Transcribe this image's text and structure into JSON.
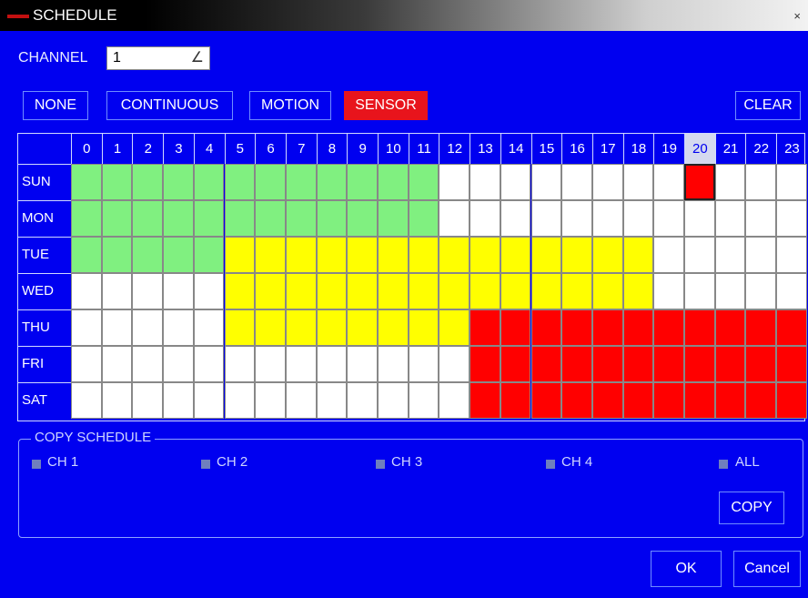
{
  "window": {
    "title": "SCHEDULE",
    "close_glyph": "×"
  },
  "channel": {
    "label": "CHANNEL",
    "value": "1",
    "dropdown_glyph": "∠"
  },
  "modes": {
    "none": "NONE",
    "continuous": "CONTINUOUS",
    "motion": "MOTION",
    "sensor": "SENSOR",
    "clear": "CLEAR"
  },
  "grid": {
    "hours": [
      "0",
      "1",
      "2",
      "3",
      "4",
      "5",
      "6",
      "7",
      "8",
      "9",
      "10",
      "11",
      "12",
      "13",
      "14",
      "15",
      "16",
      "17",
      "18",
      "19",
      "20",
      "21",
      "22",
      "23"
    ],
    "days": [
      "SUN",
      "MON",
      "TUE",
      "WED",
      "THU",
      "FRI",
      "SAT"
    ],
    "selected_hour": "20",
    "legend_colors": {
      "none": "#ffffff",
      "continuous": "#80f080",
      "motion": "#ffff00",
      "sensor": "#ff0000"
    },
    "rows": [
      [
        "C",
        "C",
        "C",
        "C",
        "C",
        "C",
        "C",
        "C",
        "C",
        "C",
        "C",
        "C",
        "N",
        "N",
        "N",
        "N",
        "N",
        "N",
        "N",
        "N",
        "S",
        "N",
        "N",
        "N"
      ],
      [
        "C",
        "C",
        "C",
        "C",
        "C",
        "C",
        "C",
        "C",
        "C",
        "C",
        "C",
        "C",
        "N",
        "N",
        "N",
        "N",
        "N",
        "N",
        "N",
        "N",
        "N",
        "N",
        "N",
        "N"
      ],
      [
        "C",
        "C",
        "C",
        "C",
        "C",
        "M",
        "M",
        "M",
        "M",
        "M",
        "M",
        "M",
        "M",
        "M",
        "M",
        "M",
        "M",
        "M",
        "M",
        "N",
        "N",
        "N",
        "N",
        "N"
      ],
      [
        "N",
        "N",
        "N",
        "N",
        "N",
        "M",
        "M",
        "M",
        "M",
        "M",
        "M",
        "M",
        "M",
        "M",
        "M",
        "M",
        "M",
        "M",
        "M",
        "N",
        "N",
        "N",
        "N",
        "N"
      ],
      [
        "N",
        "N",
        "N",
        "N",
        "N",
        "M",
        "M",
        "M",
        "M",
        "M",
        "M",
        "M",
        "M",
        "S",
        "S",
        "S",
        "S",
        "S",
        "S",
        "S",
        "S",
        "S",
        "S",
        "S"
      ],
      [
        "N",
        "N",
        "N",
        "N",
        "N",
        "N",
        "N",
        "N",
        "N",
        "N",
        "N",
        "N",
        "N",
        "S",
        "S",
        "S",
        "S",
        "S",
        "S",
        "S",
        "S",
        "S",
        "S",
        "S"
      ],
      [
        "N",
        "N",
        "N",
        "N",
        "N",
        "N",
        "N",
        "N",
        "N",
        "N",
        "N",
        "N",
        "N",
        "S",
        "S",
        "S",
        "S",
        "S",
        "S",
        "S",
        "S",
        "S",
        "S",
        "S"
      ]
    ]
  },
  "copy_schedule": {
    "legend": "COPY SCHEDULE",
    "options": [
      {
        "label": "CH 1"
      },
      {
        "label": "CH 2"
      },
      {
        "label": "CH 3"
      },
      {
        "label": "CH 4"
      },
      {
        "label": "ALL"
      }
    ],
    "copy_label": "COPY"
  },
  "footer": {
    "ok_label": "OK",
    "cancel_label": "Cancel"
  }
}
